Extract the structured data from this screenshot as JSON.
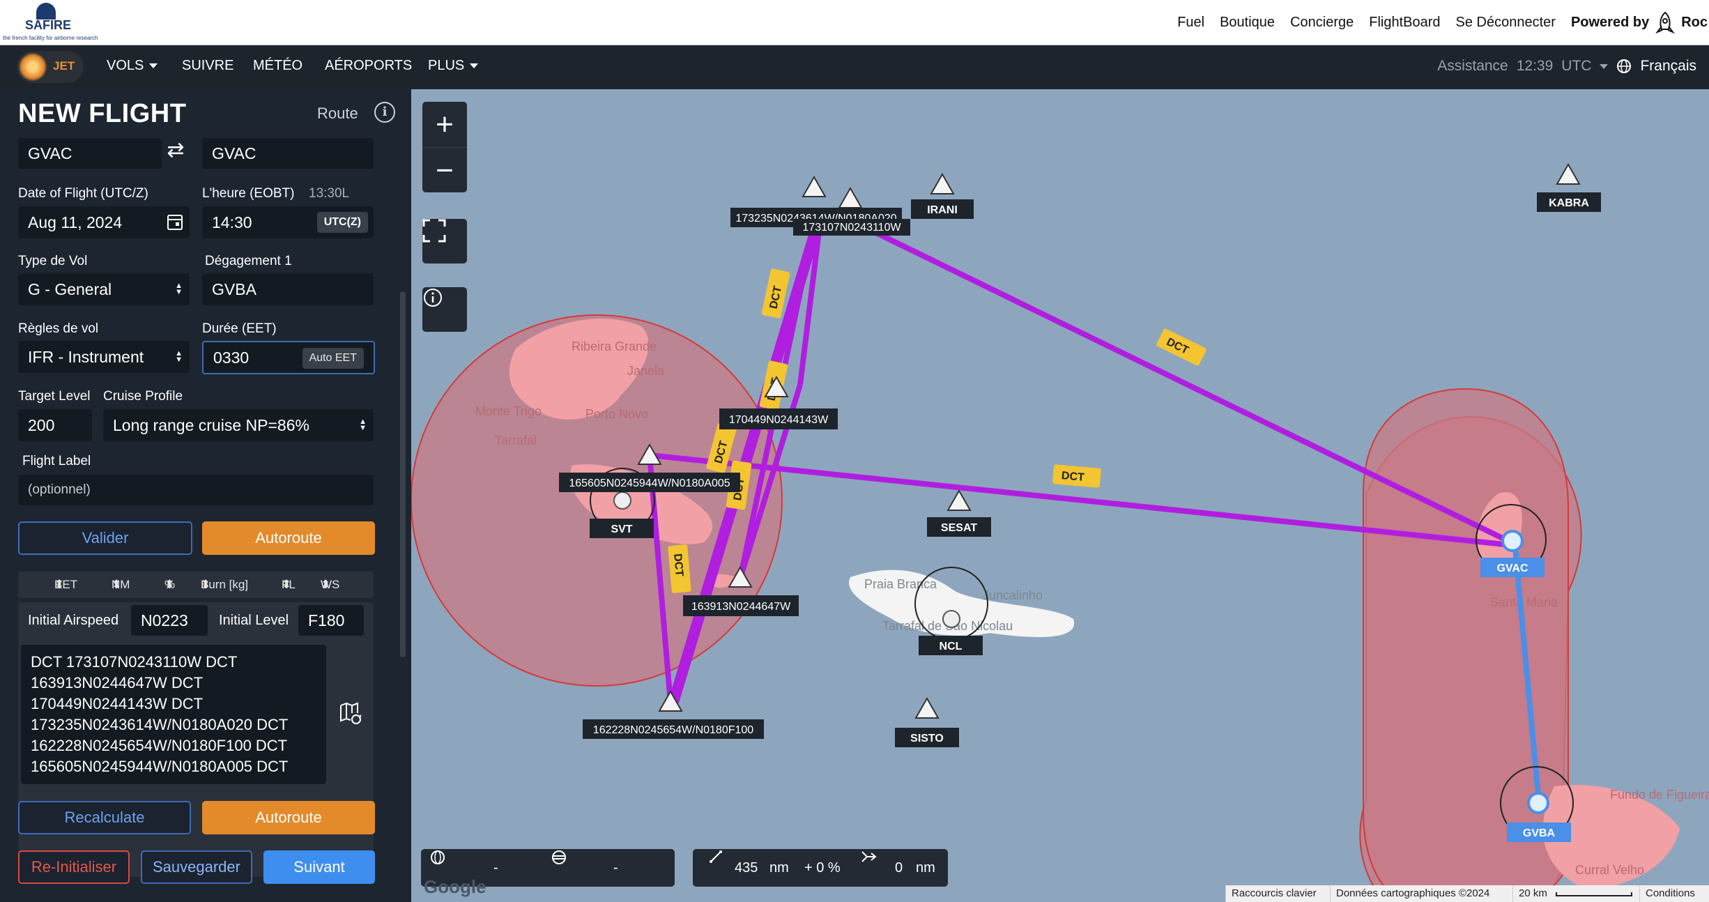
{
  "topbar": {
    "logo_name": "SAFIRE",
    "logo_tagline": "the french facility for airborne research",
    "links": [
      "Fuel",
      "Boutique",
      "Concierge",
      "FlightBoard",
      "Se Déconnecter"
    ],
    "powered_by": "Powered by",
    "powered_brand": "Roc"
  },
  "navbar": {
    "logo_text": "JET",
    "items": [
      {
        "label": "VOLS",
        "dropdown": true
      },
      {
        "label": "SUIVRE",
        "dropdown": false
      },
      {
        "label": "MÉTÉO",
        "dropdown": false
      },
      {
        "label": "AÉROPORTS",
        "dropdown": false
      },
      {
        "label": "PLUS",
        "dropdown": true
      }
    ],
    "assistance": "Assistance",
    "time": "12:39",
    "timezone": "UTC",
    "language": "Français"
  },
  "form": {
    "title": "NEW FLIGHT",
    "route_link": "Route",
    "departure": "GVAC",
    "arrival": "GVAC",
    "date_label": "Date of Flight (UTC/Z)",
    "date_value": "Aug 11, 2024",
    "eobt_label": "L'heure (EOBT)",
    "eobt_local": "13:30L",
    "eobt_value": "14:30",
    "utc_badge": "UTC(Z)",
    "type_label": "Type de Vol",
    "type_value": "G - General",
    "alternate_label": "Dégagement 1",
    "alternate_value": "GVBA",
    "rules_label": "Règles de vol",
    "rules_value": "IFR - Instrument",
    "duration_label": "Durée (EET)",
    "duration_value": "0330",
    "auto_eet": "Auto EET",
    "target_level_label": "Target Level",
    "target_level_value": "200",
    "cruise_profile_label": "Cruise Profile",
    "cruise_profile_value": "Long range cruise NP=86%",
    "flight_label_label": "Flight Label",
    "flight_label_placeholder": "(optionnel)",
    "validate_btn": "Valider",
    "autoroute_btn": "Autoroute",
    "table_headers": [
      "EET",
      "NM",
      "%",
      "Burn [kg]",
      "FL",
      "WS"
    ],
    "initial_airspeed_label": "Initial Airspeed",
    "initial_airspeed_value": "N0223",
    "initial_level_label": "Initial Level",
    "initial_level_value": "F180",
    "route_string": "DCT 173107N0243110W DCT\n163913N0244647W DCT\n170449N0244143W DCT\n173235N0243614W/N0180A020 DCT\n162228N0245654W/N0180F100 DCT\n165605N0245944W/N0180A005 DCT",
    "recalculate_btn": "Recalculate",
    "autoroute_btn2": "Autoroute",
    "reset_btn": "Re-Initialiser",
    "save_btn": "Sauvegarder",
    "next_btn": "Suivant"
  },
  "map": {
    "waypoints": [
      "IRANI",
      "KABRA",
      "173235N0243614W/N0180A020",
      "173107N0243110W",
      "170449N0244143W",
      "165605N0245944W/N0180A005",
      "SVT",
      "SESAT",
      "163913N0244647W",
      "NCL",
      "162228N0245654W/N0180F100",
      "SISTO",
      "GVAC",
      "GVBA"
    ],
    "place_names": [
      "Ribeira Grande",
      "Janela",
      "Monte Trigo",
      "Porto Novo",
      "Tarrafal",
      "Praia Branca",
      "Juncalinho",
      "Tarrafal de São Nicolau",
      "Santa Maria",
      "Fundo de Figueiras",
      "Curral Velho"
    ],
    "dct_tags": [
      "DCT",
      "DCT",
      "DCT",
      "DCT",
      "DCT",
      "DCT",
      "DCT"
    ],
    "bottom_left": {
      "v1": "-",
      "v2": "-"
    },
    "bottom_right": {
      "distance": "435",
      "dist_unit": "nm",
      "percent": "+ 0 %",
      "deviation": "0",
      "dev_unit": "nm"
    },
    "attribution": [
      "Raccourcis clavier",
      "Données cartographiques ©2024",
      "20 km",
      "Conditions"
    ],
    "google": "Google",
    "colors": {
      "route": "#b01ee0",
      "alt_route": "#4a8fe8",
      "zone": "#c97a86",
      "sea": "#8ea6bd",
      "land": "#f1a0a6",
      "tag": "#f3c531"
    }
  }
}
